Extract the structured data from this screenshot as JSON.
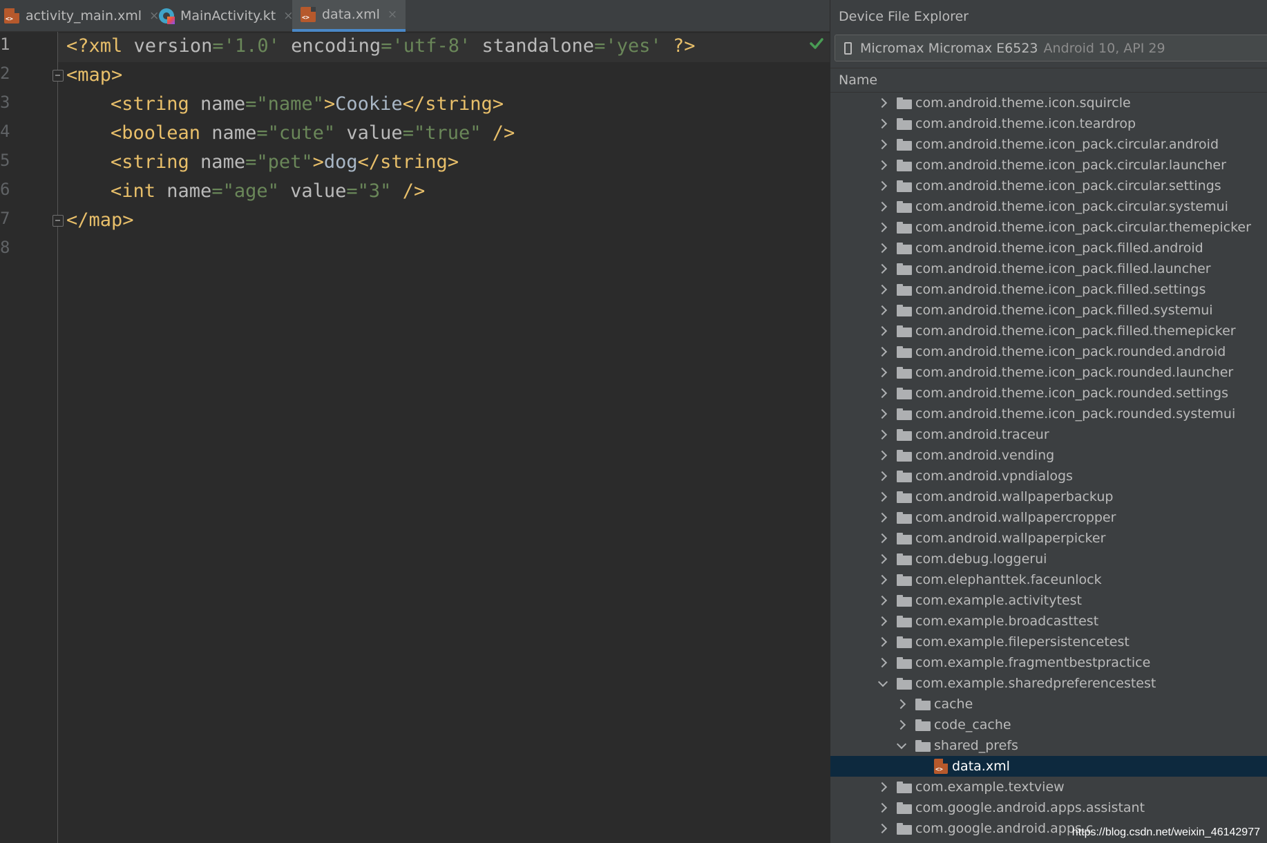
{
  "editor": {
    "tabs": [
      {
        "label": "activity_main.xml",
        "icon": "xml-file-icon",
        "active": false
      },
      {
        "label": "MainActivity.kt",
        "icon": "kotlin-file-icon",
        "active": false
      },
      {
        "label": "data.xml",
        "icon": "xml-file-icon",
        "active": true
      }
    ],
    "tab_close_glyph": "×",
    "line_numbers": [
      "1",
      "2",
      "3",
      "4",
      "5",
      "6",
      "7",
      "8"
    ],
    "code": {
      "l1": {
        "open": "<?xml",
        "a1": " version",
        "eq1": "=",
        "v1": "'1.0'",
        "a2": " encoding",
        "eq2": "=",
        "v2": "'utf-8'",
        "a3": " standalone",
        "eq3": "=",
        "v3": "'yes'",
        "close": " ?>"
      },
      "l2": {
        "tag": "<map>"
      },
      "l3": {
        "open": "<string",
        "a1": " name",
        "eq1": "=",
        "v1": "\"name\"",
        "gt": ">",
        "text": "Cookie",
        "close": "</string>"
      },
      "l4": {
        "open": "<boolean",
        "a1": " name",
        "eq1": "=",
        "v1": "\"cute\"",
        "a2": " value",
        "eq2": "=",
        "v2": "\"true\"",
        "close": " />"
      },
      "l5": {
        "open": "<string",
        "a1": " name",
        "eq1": "=",
        "v1": "\"pet\"",
        "gt": ">",
        "text": "dog",
        "close": "</string>"
      },
      "l6": {
        "open": "<int",
        "a1": " name",
        "eq1": "=",
        "v1": "\"age\"",
        "a2": " value",
        "eq2": "=",
        "v2": "\"3\"",
        "close": " />"
      },
      "l7": {
        "tag": "</map>"
      }
    },
    "inspection_status_icon": "check-icon",
    "colors": {
      "tag": "#e8bf6a",
      "attribute": "#bababa",
      "string": "#6a8759",
      "text": "#a9b7c6",
      "background": "#2b2b2b",
      "tab_underline": "#4a88c7"
    }
  },
  "device_file_explorer": {
    "title": "Device File Explorer",
    "device": {
      "name": "Micromax Micromax E6523",
      "details": "Android 10, API 29"
    },
    "column_header": "Name",
    "items": [
      {
        "label": "com.android.theme.icon.squircle",
        "type": "folder",
        "expanded": false,
        "depth": 0
      },
      {
        "label": "com.android.theme.icon.teardrop",
        "type": "folder",
        "expanded": false,
        "depth": 0
      },
      {
        "label": "com.android.theme.icon_pack.circular.android",
        "type": "folder",
        "expanded": false,
        "depth": 0
      },
      {
        "label": "com.android.theme.icon_pack.circular.launcher",
        "type": "folder",
        "expanded": false,
        "depth": 0
      },
      {
        "label": "com.android.theme.icon_pack.circular.settings",
        "type": "folder",
        "expanded": false,
        "depth": 0
      },
      {
        "label": "com.android.theme.icon_pack.circular.systemui",
        "type": "folder",
        "expanded": false,
        "depth": 0
      },
      {
        "label": "com.android.theme.icon_pack.circular.themepicker",
        "type": "folder",
        "expanded": false,
        "depth": 0
      },
      {
        "label": "com.android.theme.icon_pack.filled.android",
        "type": "folder",
        "expanded": false,
        "depth": 0
      },
      {
        "label": "com.android.theme.icon_pack.filled.launcher",
        "type": "folder",
        "expanded": false,
        "depth": 0
      },
      {
        "label": "com.android.theme.icon_pack.filled.settings",
        "type": "folder",
        "expanded": false,
        "depth": 0
      },
      {
        "label": "com.android.theme.icon_pack.filled.systemui",
        "type": "folder",
        "expanded": false,
        "depth": 0
      },
      {
        "label": "com.android.theme.icon_pack.filled.themepicker",
        "type": "folder",
        "expanded": false,
        "depth": 0
      },
      {
        "label": "com.android.theme.icon_pack.rounded.android",
        "type": "folder",
        "expanded": false,
        "depth": 0
      },
      {
        "label": "com.android.theme.icon_pack.rounded.launcher",
        "type": "folder",
        "expanded": false,
        "depth": 0
      },
      {
        "label": "com.android.theme.icon_pack.rounded.settings",
        "type": "folder",
        "expanded": false,
        "depth": 0
      },
      {
        "label": "com.android.theme.icon_pack.rounded.systemui",
        "type": "folder",
        "expanded": false,
        "depth": 0
      },
      {
        "label": "com.android.traceur",
        "type": "folder",
        "expanded": false,
        "depth": 0
      },
      {
        "label": "com.android.vending",
        "type": "folder",
        "expanded": false,
        "depth": 0
      },
      {
        "label": "com.android.vpndialogs",
        "type": "folder",
        "expanded": false,
        "depth": 0
      },
      {
        "label": "com.android.wallpaperbackup",
        "type": "folder",
        "expanded": false,
        "depth": 0
      },
      {
        "label": "com.android.wallpapercropper",
        "type": "folder",
        "expanded": false,
        "depth": 0
      },
      {
        "label": "com.android.wallpaperpicker",
        "type": "folder",
        "expanded": false,
        "depth": 0
      },
      {
        "label": "com.debug.loggerui",
        "type": "folder",
        "expanded": false,
        "depth": 0
      },
      {
        "label": "com.elephanttek.faceunlock",
        "type": "folder",
        "expanded": false,
        "depth": 0
      },
      {
        "label": "com.example.activitytest",
        "type": "folder",
        "expanded": false,
        "depth": 0
      },
      {
        "label": "com.example.broadcasttest",
        "type": "folder",
        "expanded": false,
        "depth": 0
      },
      {
        "label": "com.example.filepersistencetest",
        "type": "folder",
        "expanded": false,
        "depth": 0
      },
      {
        "label": "com.example.fragmentbestpractice",
        "type": "folder",
        "expanded": false,
        "depth": 0
      },
      {
        "label": "com.example.sharedpreferencestest",
        "type": "folder",
        "expanded": true,
        "depth": 0
      },
      {
        "label": "cache",
        "type": "folder",
        "expanded": false,
        "depth": 1
      },
      {
        "label": "code_cache",
        "type": "folder",
        "expanded": false,
        "depth": 1
      },
      {
        "label": "shared_prefs",
        "type": "folder",
        "expanded": true,
        "depth": 1
      },
      {
        "label": "data.xml",
        "type": "xml-file",
        "expanded": false,
        "depth": 2,
        "selected": true
      },
      {
        "label": "com.example.textview",
        "type": "folder",
        "expanded": false,
        "depth": 0
      },
      {
        "label": "com.google.android.apps.assistant",
        "type": "folder",
        "expanded": false,
        "depth": 0
      },
      {
        "label": "com.google.android.apps.c",
        "type": "folder",
        "expanded": false,
        "depth": 0
      }
    ],
    "colors": {
      "panel_background": "#3c3f41",
      "selection": "#0d293e"
    }
  },
  "watermark": "https://blog.csdn.net/weixin_46142977"
}
